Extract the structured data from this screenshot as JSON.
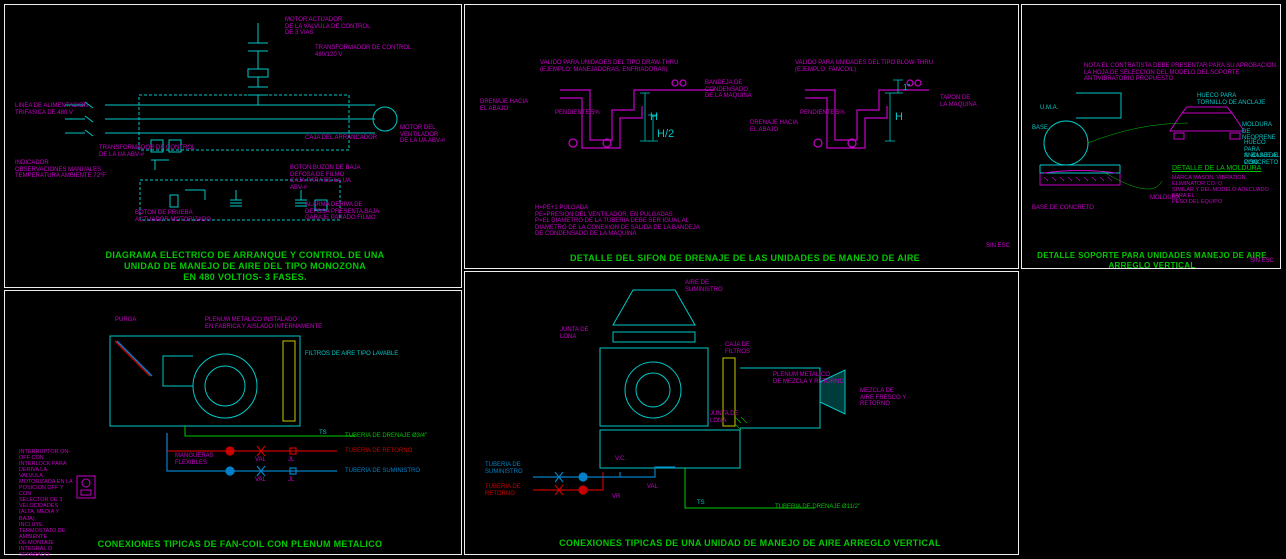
{
  "panels": {
    "p1": {
      "title": "DIAGRAMA ELECTRICO DE ARRANQUE Y CONTROL DE UNA\nUNIDAD DE MANEJO DE AIRE DEL TIPO MONOZONA\nEN 480 VOLTIOS- 3 FASES.",
      "labels": {
        "l1": "LINEA DE ALIMENTACION\nTRIFASICA DE 480 V",
        "l2": "MOTOR DEL VENTILADOR\nDE LA UA ABV-#",
        "l3": "TRANSFORMADOR DE CONTROL\n480/120 V",
        "l4": "CAJA DEL ARRANCADOR",
        "l5": "BOTON DE PRUEBA\nACTUADOR MOTORIZADO",
        "l6": "MOTOR ACTUADOR\nDE LA VALVULA DE CONTROL\nDE 3 VIAS",
        "l7": "TRANSFORMADOR DE CONTROL\nDE LA UA ABV-#",
        "l8": "INDICADOR\nOBSERVACIONES MANUALES\nTEMPERATURA AMBIENTE 72°F",
        "l9": "BOTON BUZON DE BAJA\nDEFOSA DE FILMO\nCAJA PARA DE LA UA\nABV-#",
        "l10": "ALARMA DERIVA DE\nDEFOSA PRESENTA BAJA\nGARAJE PARADO FILMO"
      }
    },
    "p2": {
      "title": "DETALLE DEL SIFON DE DRENAJE DE LAS UNIDADES DE MANEJO DE AIRE",
      "scale": "SIN ESC",
      "formula": "H=PE+1 PULGADA\nPE=PRESION DEL VENTILADOR, EN PULGADAS\nP=EL DIAMETRO DE LA TUBERIA DEBE SER IGUAL AL\nDIAMETRO DE LA CONEXION DE SALIDA DE LA BANDEJA\nDE CONDENSADO DE LA MAQUINA",
      "labels": {
        "l1": "VALIDO PARA UNIDADES DEL TIPO DRAW-THRU\n(EJEMPLO: MANEJADORAS, ENFRIADORAS)",
        "l2": "VALIDO PARA UNIDADES DEL TIPO BLOW-THRU\n(EJEMPLO: FANCOIL)",
        "l3": "BANDEJA DE\nCONDENSADO\nDE LA MAQUINA",
        "l4": "DRENAJE HACIA\nEL ABAJO",
        "l5": "PENDIENTE 5%",
        "l6": "H",
        "l7": "H/2",
        "l8": "1\"",
        "l9": "TAPON DE\nLA MAQUINA"
      }
    },
    "p3": {
      "title": "DETALLE SOPORTE PARA UNIDADES MANEJO DE AIRE ARREGLO VERTICAL",
      "scale": "SIN ESC",
      "note": "NOTA EL CONTRATISTA DEBE PRESENTAR PARA SU APROBACION\nLA HOJA DE SELECCION DEL MODELO DEL SOPORTE\nANTIVIBRATORIO PROPUESTO",
      "subtitle": "DETALLE DE LA MOLDURA",
      "subnote": "MARCA MASON, VIBRATION ELIMINATOR CO. O\nSIMILAR Y DEL MODELO ADECUADO PARA EL\nPESO DEL EQUIPO",
      "labels": {
        "l1": "U.M.A.",
        "l2": "BASE",
        "l3": "HUECO PARA\nTORNILLO DE ANCLAJE",
        "l4": "MOLDURA DE NEOPRENE",
        "l5": "HUECO PARA\nANCLAJE AL PISO",
        "l6": "SI BASE DE CONCRETO",
        "l7": "MOLDURA",
        "l8": "BASE DE CONCRETO"
      }
    },
    "p4": {
      "title": "CONEXIONES TIPICAS DE FAN-COIL CON PLENUM METALICO",
      "labels": {
        "l1": "PURGA",
        "l2": "PLENUM METALICO INSTALADO\nEN FABRICA Y AISLADO INTERNAMENTE",
        "l3": "FILTROS DE AIRE TIPO LAVABLE",
        "l4": "TS",
        "l5": "TUBERIA DE DRENAJE Ø3/4\"",
        "l6": "TUBERIA DE RETORNO",
        "l7": "TUBERIA DE SUMINISTRO",
        "l8": "MANGUERAS\nFLEXIBLES",
        "l9": "VAL",
        "l10": "JL",
        "l11": "INTERRUPTOR ON-OFF CON\nINTERLOCK PARA DERIVA LA\nVALVULA MOTORIZADA EN LA\nPOSICION OFF Y CON\nSELECTOR DE 3 VELOCIDADES\n(ALTA, MEDIA Y BAJA)\nINCLUYE TERMOSTATO DE AMBIENTE\nDE MONTAJE INTEGRAL O SEPARADO"
      }
    },
    "p5": {
      "title": "CONEXIONES TIPICAS DE UNA UNIDAD DE MANEJO DE AIRE ARREGLO VERTICAL",
      "labels": {
        "l1": "AIRE DE\nSUMINISTRO",
        "l2": "JUNTA DE\nLONA",
        "l3": "CAJA DE\nFILTROS",
        "l4": "PLENUM METALICO\nDE MEZCLA Y RETORNO",
        "l5": "MEZCLA DE\nAIRE FRESCO Y\nRETORNO",
        "l6": "TUBERIA DE\nSUMINISTRO",
        "l7": "TUBERIA DE\nRETORNO",
        "l8": "VAL",
        "l9": "V.C.",
        "l10": "VR",
        "l11": "TS",
        "l12": "TUBERIA DE DRENAJE Ø11/2\"",
        "l13": "JUNTA DE\nLONA"
      }
    }
  }
}
